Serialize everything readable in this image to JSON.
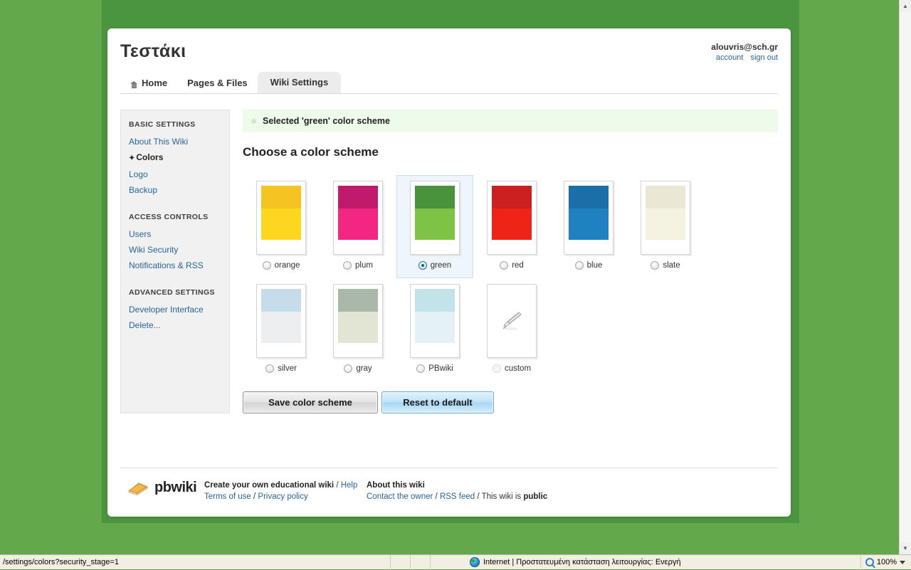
{
  "browser": {
    "status_url": "/settings/colors?security_stage=1",
    "zone_text": "Internet | Προστατευμένη κατάσταση λειτουργίας: Ενεργή",
    "zone_icon": "globe-icon",
    "zoom_level": "100%",
    "zoom_icon": "zoom-magnifier-icon",
    "scroll_up_glyph": "▲",
    "scroll_down_glyph": "▼"
  },
  "header": {
    "wiki_title": "Τεστάκι",
    "account_email": "alouvris@sch.gr",
    "account_link": "account",
    "signout_link": "sign out"
  },
  "tabs": [
    {
      "label": "Home",
      "icon": "home-icon",
      "active": false
    },
    {
      "label": "Pages & Files",
      "icon": null,
      "active": false
    },
    {
      "label": "Wiki Settings",
      "icon": null,
      "active": true
    }
  ],
  "sidebar": {
    "groups": [
      {
        "title": "BASIC SETTINGS",
        "items": [
          {
            "label": "About This Wiki",
            "current": false
          },
          {
            "label": "Colors",
            "current": true,
            "arrow": "✦"
          },
          {
            "label": "Logo",
            "current": false
          },
          {
            "label": "Backup",
            "current": false
          }
        ]
      },
      {
        "title": "ACCESS CONTROLS",
        "items": [
          {
            "label": "Users",
            "current": false
          },
          {
            "label": "Wiki Security",
            "current": false
          },
          {
            "label": "Notifications & RSS",
            "current": false
          }
        ]
      },
      {
        "title": "ADVANCED SETTINGS",
        "items": [
          {
            "label": "Developer Interface",
            "current": false
          },
          {
            "label": "Delete...",
            "current": false
          }
        ]
      }
    ]
  },
  "main": {
    "flash_message": "Selected 'green' color scheme",
    "flash_bg": "#eefaea",
    "heading": "Choose a color scheme",
    "schemes": [
      {
        "name": "orange",
        "selected": false,
        "disabled": false,
        "top": "#f5c423",
        "bottom": "#fcd61f",
        "kind": "color"
      },
      {
        "name": "plum",
        "selected": false,
        "disabled": false,
        "top": "#c01a6d",
        "bottom": "#f22683",
        "kind": "color"
      },
      {
        "name": "green",
        "selected": true,
        "disabled": false,
        "top": "#49933c",
        "bottom": "#7ec346",
        "kind": "color"
      },
      {
        "name": "red",
        "selected": false,
        "disabled": false,
        "top": "#cc1f1f",
        "bottom": "#ef2418",
        "kind": "color"
      },
      {
        "name": "blue",
        "selected": false,
        "disabled": false,
        "top": "#1a6fa8",
        "bottom": "#1f81bf",
        "kind": "color"
      },
      {
        "name": "slate",
        "selected": false,
        "disabled": false,
        "top": "#eae7d5",
        "bottom": "#f4f2e0",
        "kind": "color"
      },
      {
        "name": "silver",
        "selected": false,
        "disabled": false,
        "top": "#c7dcea",
        "bottom": "#eceef0",
        "kind": "color"
      },
      {
        "name": "gray",
        "selected": false,
        "disabled": false,
        "top": "#a9b8a9",
        "bottom": "#e3e5d4",
        "kind": "color"
      },
      {
        "name": "PBwiki",
        "selected": false,
        "disabled": false,
        "top": "#c3e3ea",
        "bottom": "#e4f2f8",
        "kind": "color"
      },
      {
        "name": "custom",
        "selected": false,
        "disabled": true,
        "top": "#ffffff",
        "bottom": "#ffffff",
        "kind": "brush",
        "icon": "paintbrush-icon"
      }
    ],
    "save_button": "Save color scheme",
    "reset_button": "Reset to default"
  },
  "footer": {
    "logo_text": "pbwiki",
    "logo_icon": "pb-sandwich-icon",
    "col1_line1_link": "Create your own educational wiki",
    "col1_line1_sep": " / ",
    "col1_line1_help": "Help",
    "col1_line2_terms": "Terms of use",
    "col1_line2_sep": " / ",
    "col1_line2_privacy": "Privacy policy",
    "col2_title": "About this wiki",
    "col2_contact": "Contact the owner",
    "col2_sep1": " / ",
    "col2_rss": "RSS feed",
    "col2_sep2": " / ",
    "col2_prefix": "This wiki is ",
    "col2_visibility": "public"
  },
  "theme": {
    "page_bg": "#63a84a",
    "frame_bg": "#4b9440",
    "accent_link": "#27649a",
    "active_tab_bg": "#ececec",
    "sidebar_bg": "#f1f1f1",
    "selected_cell_bg": "#eef6fc",
    "selected_cell_border": "#cbdff0"
  }
}
